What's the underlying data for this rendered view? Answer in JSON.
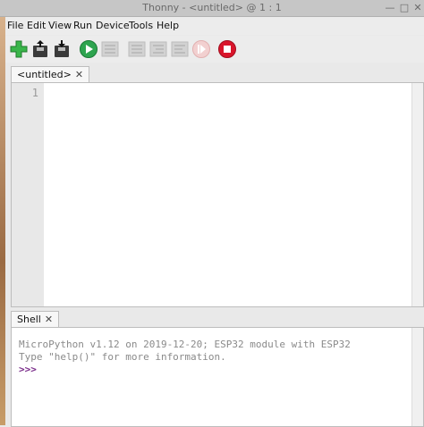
{
  "window": {
    "title": "Thonny  -  <untitled>  @  1 : 1"
  },
  "menu": [
    "File",
    "Edit",
    "View",
    "Run",
    "Device",
    "Tools",
    "Help"
  ],
  "toolbar_icons": [
    "new-file-icon",
    "open-file-icon",
    "save-file-icon",
    "run-icon",
    "debug-icon",
    "step-over-icon",
    "step-into-icon",
    "step-out-icon",
    "resume-icon",
    "stop-icon"
  ],
  "editor": {
    "tab_label": "<untitled>",
    "tab_close": "✕",
    "line_numbers": [
      "1"
    ]
  },
  "shell": {
    "tab_label": "Shell",
    "tab_close": "✕",
    "line1": "MicroPython v1.12 on 2019-12-20; ESP32 module with ESP32",
    "line2": "Type \"help()\" for more information.",
    "prompt": ">>>"
  },
  "colors": {
    "run": "#2ea44f",
    "stop": "#d9152b",
    "new": "#39b54a",
    "prompt": "#7a2d8a"
  }
}
